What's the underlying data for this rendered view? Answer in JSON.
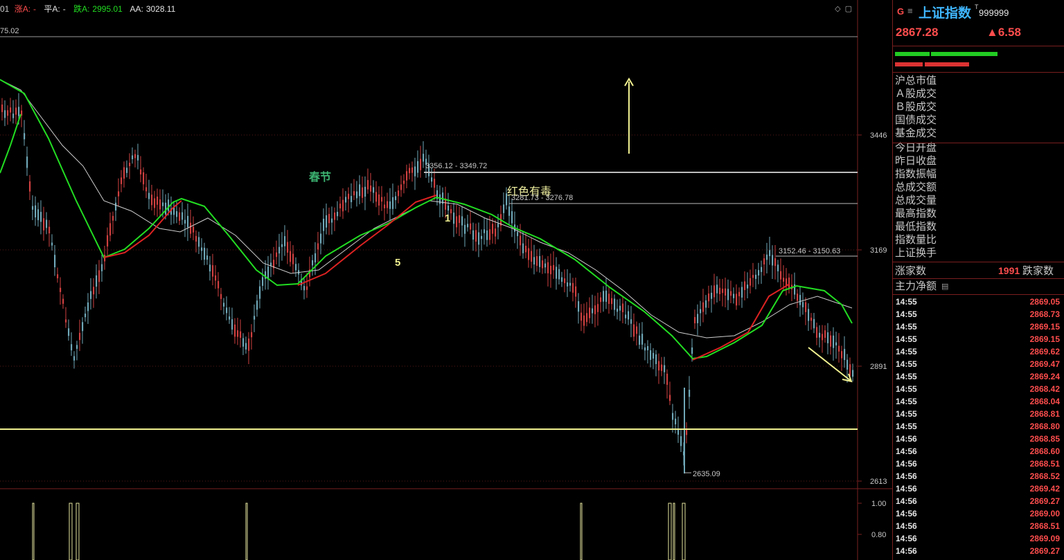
{
  "topbar": {
    "prefix": "01",
    "up_label": "涨A:",
    "up_value": "-",
    "flat_label": "平A:",
    "flat_value": "-",
    "down_label": "跌A:",
    "down_value": "2995.01",
    "aa_label": "AA:",
    "aa_value": "3028.11",
    "level_label": "75.02"
  },
  "chart": {
    "price_axis": [
      "3446",
      "3169",
      "2891",
      "2613"
    ],
    "volume_axis": [
      "1.00",
      "0.80"
    ],
    "annotations": {
      "spring": "春节",
      "poison": "红色有毒",
      "wave5": "5",
      "wave1": "1",
      "range1": "3356.12 - 3349.72",
      "range2": "3281.73 - 3276.78",
      "range3": "3152.46 - 3150.63",
      "low": "2635.09"
    },
    "colors": {
      "up": "#d04040",
      "down": "#6fa8b8",
      "ma_green": "#22dd22",
      "ma_red": "#dd2222",
      "ma_white": "#cfcfcf",
      "yellow": "#f0f090",
      "axis_red": "#7a1f1f"
    }
  },
  "panel": {
    "market": "G",
    "menu_icon": "menu-icon",
    "name": "上证指数",
    "name_sup": "T",
    "code": "999999",
    "price": "2867.28",
    "change": "▲6.58",
    "rows": [
      "沪总市值",
      "Ａ股成交",
      "Ｂ股成交",
      "国债成交",
      "基金成交",
      "今日开盘",
      "昨日收盘",
      "指数振幅",
      "总成交额",
      "总成交量",
      "最高指数",
      "最低指数",
      "指数量比",
      "上证换手"
    ],
    "adv_label": "涨家数",
    "adv_value": "1991",
    "dec_label": "跌家数",
    "netflow": "主力净额",
    "ticks": [
      {
        "t": "14:55",
        "p": "2869.05"
      },
      {
        "t": "14:55",
        "p": "2868.73"
      },
      {
        "t": "14:55",
        "p": "2869.15"
      },
      {
        "t": "14:55",
        "p": "2869.15"
      },
      {
        "t": "14:55",
        "p": "2869.62"
      },
      {
        "t": "14:55",
        "p": "2869.47"
      },
      {
        "t": "14:55",
        "p": "2869.24"
      },
      {
        "t": "14:55",
        "p": "2868.42"
      },
      {
        "t": "14:55",
        "p": "2868.04"
      },
      {
        "t": "14:55",
        "p": "2868.81"
      },
      {
        "t": "14:55",
        "p": "2868.80"
      },
      {
        "t": "14:56",
        "p": "2868.85"
      },
      {
        "t": "14:56",
        "p": "2868.60"
      },
      {
        "t": "14:56",
        "p": "2868.51"
      },
      {
        "t": "14:56",
        "p": "2868.52"
      },
      {
        "t": "14:56",
        "p": "2869.42"
      },
      {
        "t": "14:56",
        "p": "2869.27"
      },
      {
        "t": "14:56",
        "p": "2869.00"
      },
      {
        "t": "14:56",
        "p": "2868.51"
      },
      {
        "t": "14:56",
        "p": "2869.09"
      },
      {
        "t": "14:56",
        "p": "2869.27"
      }
    ]
  }
}
